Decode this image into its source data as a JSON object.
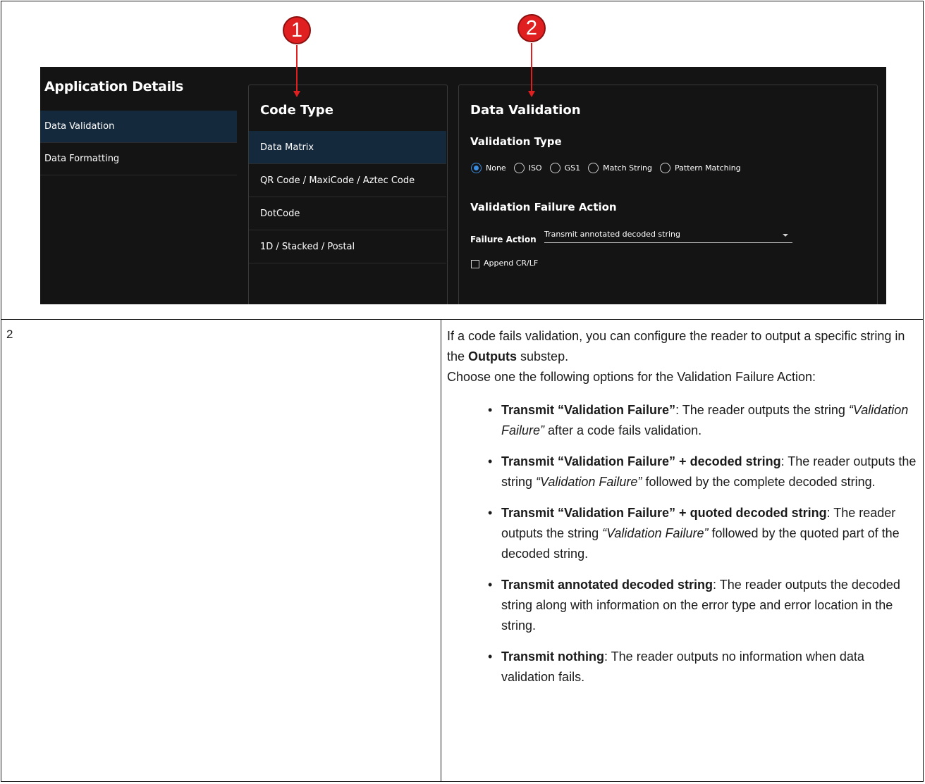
{
  "app": {
    "title": "Application Details",
    "nav": [
      {
        "label": "Data Validation",
        "active": true
      },
      {
        "label": "Data Formatting",
        "active": false
      }
    ]
  },
  "code_type": {
    "title": "Code Type",
    "items": [
      {
        "label": "Data Matrix",
        "active": true
      },
      {
        "label": "QR Code / MaxiCode / Aztec Code",
        "active": false
      },
      {
        "label": "DotCode",
        "active": false
      },
      {
        "label": "1D / Stacked / Postal",
        "active": false
      }
    ]
  },
  "data_validation": {
    "title": "Data Validation",
    "validation_type_label": "Validation Type",
    "options": [
      {
        "label": "None",
        "selected": true
      },
      {
        "label": "ISO",
        "selected": false
      },
      {
        "label": "GS1",
        "selected": false
      },
      {
        "label": "Match String",
        "selected": false
      },
      {
        "label": "Pattern Matching",
        "selected": false
      }
    ],
    "failure_heading": "Validation Failure Action",
    "failure_action_label": "Failure Action",
    "failure_action_value": "Transmit annotated decoded string",
    "append_label": "Append CR/LF",
    "append_checked": false
  },
  "callouts": {
    "one": "1",
    "two": "2"
  },
  "table": {
    "row_number": "2",
    "intro1_a": "If a code fails validation, you can configure the reader to output a specific string in the ",
    "intro1_b": "Outputs",
    "intro1_c": " substep.",
    "intro2": "Choose one the following options for the Validation Failure Action:",
    "bullets": [
      {
        "bold": "Transmit “Validation Failure”",
        "t1": ": The reader outputs the string ",
        "ital": "“Validation Failure”",
        "t2": " after a code fails validation."
      },
      {
        "bold": "Transmit “Validation Failure” + decoded string",
        "t1": ": The reader outputs the string ",
        "ital": "“Validation Failure”",
        "t2": " followed by the complete decoded string."
      },
      {
        "bold": "Transmit “Validation Failure” + quoted decoded string",
        "t1": ": The reader outputs the string ",
        "ital": "“Validation Failure”",
        "t2": " followed by the quoted part of the decoded string."
      },
      {
        "bold": "Transmit annotated decoded string",
        "t1": ": The reader outputs the decoded string along with information on the error type and error location in the string.",
        "ital": "",
        "t2": ""
      },
      {
        "bold": "Transmit nothing",
        "t1": ": The reader outputs no information when data validation fails.",
        "ital": "",
        "t2": ""
      }
    ]
  },
  "colors": {
    "accent": "#3a8ee6",
    "callout": "#e02020",
    "selected_bg": "#15293d",
    "screen_bg": "#141414"
  }
}
